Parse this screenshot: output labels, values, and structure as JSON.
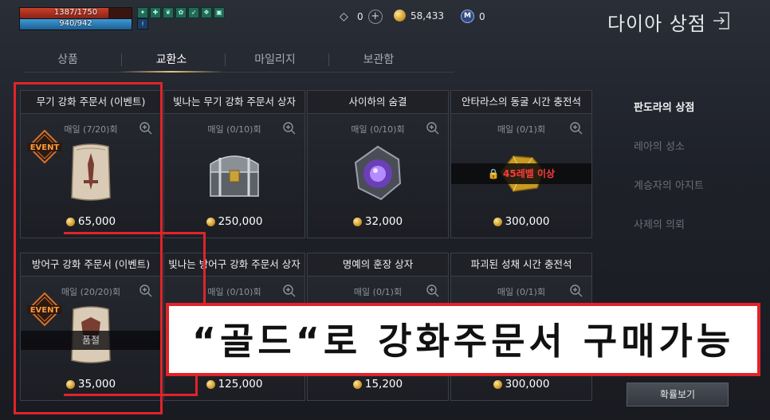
{
  "status": {
    "hp_text": "1387/1750",
    "hp_fraction": 0.79,
    "mp_text": "940/942",
    "mp_fraction": 0.998
  },
  "currency": {
    "diamond": "0",
    "gold": "58,433",
    "mileage": "0"
  },
  "shop_title": "다이아 상점",
  "tabs": [
    {
      "label": "상품"
    },
    {
      "label": "교환소"
    },
    {
      "label": "마일리지"
    },
    {
      "label": "보관함"
    }
  ],
  "active_tab": "교환소",
  "items": [
    {
      "title": "무기 강화 주문서 (이벤트)",
      "daily": "매일 (7/20)회",
      "price": "65,000",
      "art": "weapon-scroll",
      "event_badge": "EVENT"
    },
    {
      "title": "빛나는 무기 강화 주문서 상자",
      "daily": "매일 (0/10)회",
      "price": "250,000",
      "art": "chest"
    },
    {
      "title": "사이하의 숨결",
      "daily": "매일 (0/10)회",
      "price": "32,000",
      "art": "purple-gem"
    },
    {
      "title": "안타라스의 동굴 시간 충전석",
      "daily": "매일 (0/1)회",
      "price": "300,000",
      "art": "gold-ore",
      "lock": "45레벨 이상"
    },
    {
      "title": "방어구 강화 주문서 (이벤트)",
      "daily": "매일 (20/20)회",
      "price": "35,000",
      "art": "armor-scroll",
      "event_badge": "EVENT",
      "soldout": "품절"
    },
    {
      "title": "빛나는 방어구 강화 주문서 상자",
      "daily": "매일 (0/10)회",
      "price": "125,000",
      "art": "chest"
    },
    {
      "title": "명예의 훈장 상자",
      "daily": "매일 (0/1)회",
      "price": "15,200",
      "art": "box"
    },
    {
      "title": "파괴된 성채 시간 충전석",
      "daily": "매일 (0/1)회",
      "price": "300,000",
      "art": "gold-ore"
    }
  ],
  "side_menu": [
    {
      "label": "판도라의 상점",
      "active": true
    },
    {
      "label": "레아의 성소"
    },
    {
      "label": "계승자의 아지트"
    },
    {
      "label": "사제의 의뢰"
    }
  ],
  "probability_button": "확률보기",
  "annotation": "“골드“로 강화주문서 구매가능",
  "colors": {
    "annotation_red": "#e0242a",
    "gold": "#c9901e",
    "lock_red": "#ff3b3b"
  }
}
